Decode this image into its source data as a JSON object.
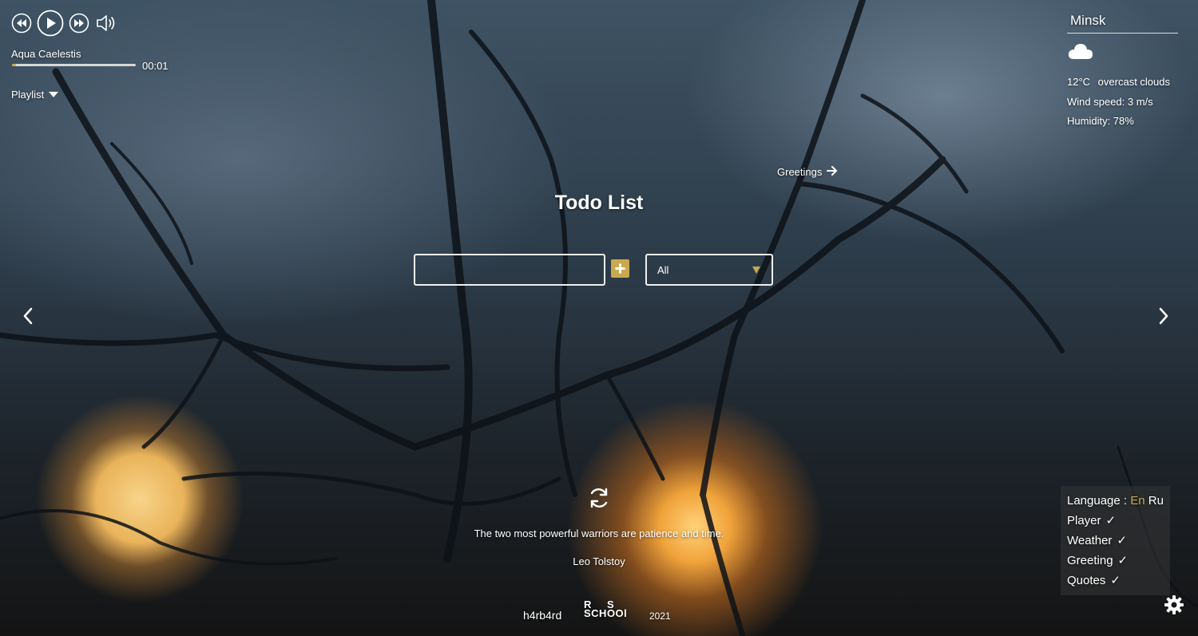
{
  "player": {
    "track_name": "Aqua Caelestis",
    "time": "00:01",
    "progress": 0.03,
    "playlist_label": "Playlist",
    "icons": [
      "rewind-icon",
      "play-icon",
      "fast-forward-icon",
      "volume-icon"
    ]
  },
  "weather": {
    "city": "Minsk",
    "icon": "cloud-icon",
    "temperature": "12°C",
    "description": "overcast clouds",
    "wind": "Wind speed: 3 m/s",
    "humidity": "Humidity: 78%"
  },
  "greeting": {
    "label": "Greetings"
  },
  "todo": {
    "title": "Todo List",
    "input_value": "",
    "filter_value": "All"
  },
  "quote": {
    "text": "The two most powerful warriors are patience and time.",
    "author": "Leo Tolstoy"
  },
  "settings": {
    "language_label": "Language :",
    "lang_en": "En",
    "lang_ru": "Ru",
    "items": [
      {
        "label": "Player",
        "check": "✓"
      },
      {
        "label": "Weather",
        "check": "✓"
      },
      {
        "label": "Greeting",
        "check": "✓"
      },
      {
        "label": "Quotes",
        "check": "✓"
      }
    ]
  },
  "footer": {
    "author": "h4rb4rd",
    "logo_top": "R S",
    "logo_bottom": "SCHOOl",
    "year": "2021"
  },
  "colors": {
    "accent": "#c9a94f",
    "text": "#ffffff"
  }
}
